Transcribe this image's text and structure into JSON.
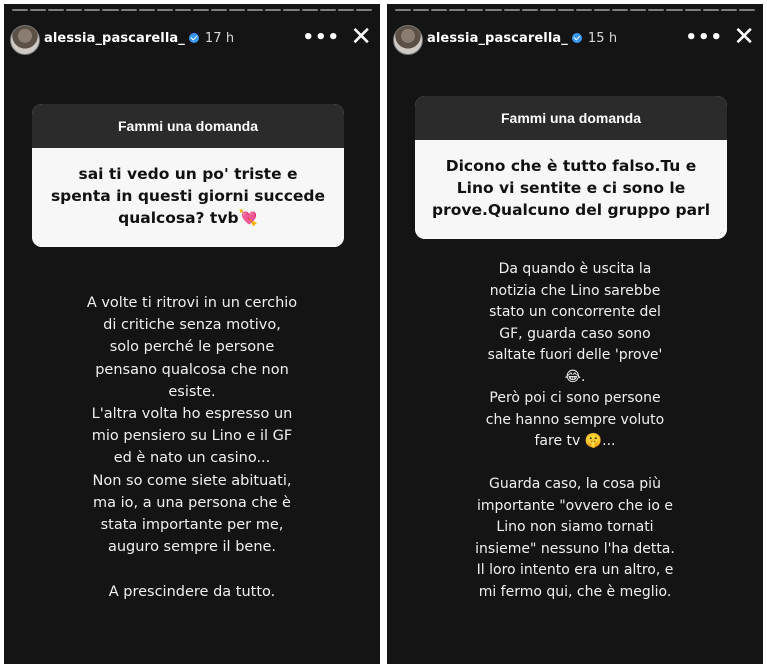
{
  "stories": [
    {
      "username": "alessia_pascarella_",
      "time": "17 h",
      "more_label": "•••",
      "close_label": "✕",
      "question_card": {
        "title": "Fammi una domanda",
        "question": "sai ti vedo un po' triste e spenta in questi giorni succede qualcosa? tvb💘"
      },
      "text": "A volte ti ritrovi in un cerchio\ndi critiche senza motivo,\nsolo perché le persone\npensano qualcosa che non\nesiste.\nL'altra volta ho espresso un\nmio pensiero su Lino e il GF\ned è nato un casino...\nNon so come siete abituati,\nma io, a una persona che è\nstata importante per me,\nauguro sempre il bene.\n\nA prescindere da tutto."
    },
    {
      "username": "alessia_pascarella_",
      "time": "15 h",
      "more_label": "•••",
      "close_label": "✕",
      "question_card": {
        "title": "Fammi una domanda",
        "question": "Dicono che è tutto falso.Tu e Lino vi sentite e ci sono le prove.Qualcuno del gruppo parl"
      },
      "text": "Da quando è uscita la\nnotizia che Lino sarebbe\nstato un concorrente del\nGF, guarda caso sono\nsaltate fuori delle 'prove'\n😂.\nPerò poi ci sono persone\nche hanno sempre voluto\nfare tv 🤫...\n\nGuarda caso, la cosa più\nimportante \"ovvero che io e\nLino non siamo tornati\ninsieme\" nessuno l'ha detta.\nIl loro intento era un altro, e\nmi fermo qui, che è meglio."
    }
  ]
}
